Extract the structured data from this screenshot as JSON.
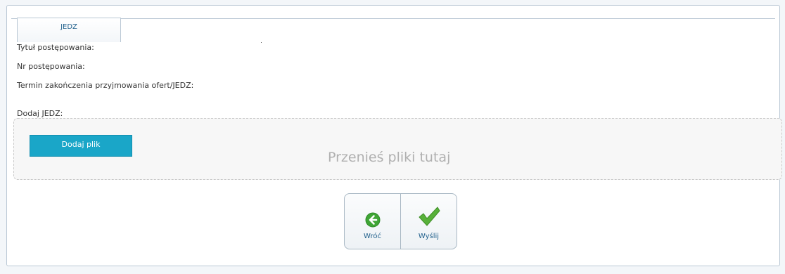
{
  "tab": {
    "label": "JEDZ"
  },
  "form": {
    "title_label": "Tytuł postępowania:",
    "number_label": "Nr postępowania:",
    "deadline_label": "Termin zakończenia przyjmowania ofert/JEDZ:",
    "add_jedz_label": "Dodaj JEDZ:"
  },
  "upload": {
    "add_file_label": "Dodaj plik",
    "drop_hint": "Przenieś pliki tutaj"
  },
  "actions": {
    "back_label": "Wróć",
    "send_label": "Wyślij"
  },
  "colors": {
    "accent": "#1aa6c8",
    "link": "#1f5f8b",
    "back_icon": "#3fa535",
    "send_icon": "#58b13a"
  },
  "icons": {
    "back": "arrow-left-circle-icon",
    "send": "checkmark-icon"
  }
}
